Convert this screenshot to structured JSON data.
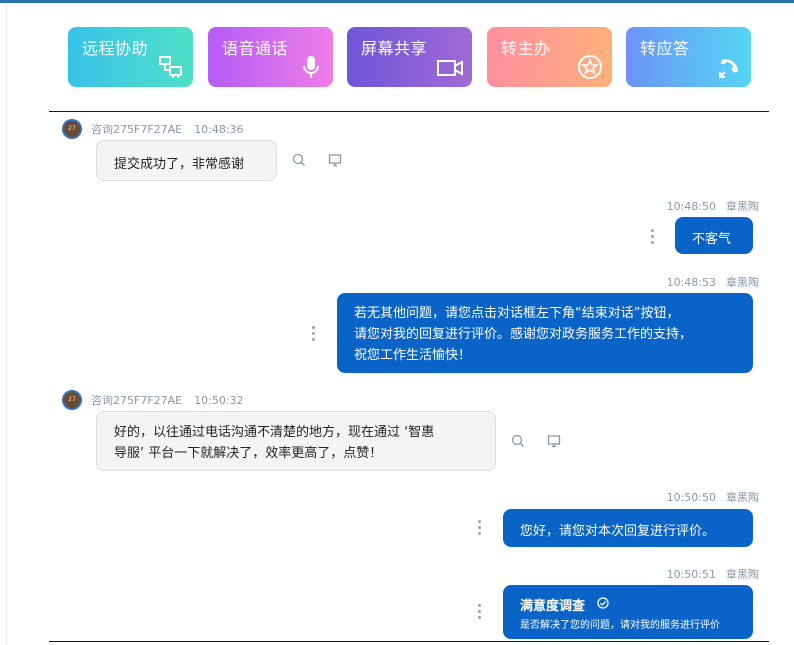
{
  "actions": [
    {
      "label": "远程协助",
      "icon": "remote-assist-icon"
    },
    {
      "label": "语音通话",
      "icon": "microphone-icon"
    },
    {
      "label": "屏幕共享",
      "icon": "video-camera-icon"
    },
    {
      "label": "转主办",
      "icon": "star-circle-icon"
    },
    {
      "label": "转应答",
      "icon": "phone-transfer-icon"
    }
  ],
  "messages": [
    {
      "sender": "咨询275F7F27AE",
      "time": "10:48:36",
      "avatar_text": "27",
      "text": "提交成功了，非常感谢"
    },
    {
      "sender": "章黑陶",
      "time": "10:48:50",
      "text": "不客气"
    },
    {
      "sender": "章黑陶",
      "time": "10:48:53",
      "lines": [
        "若无其他问题，请您点击对话框左下角“结束对话”按钮，",
        "请您对我的回复进行评价。感谢您对政务服务工作的支持，",
        "祝您工作生活愉快！"
      ]
    },
    {
      "sender": "咨询275F7F27AE",
      "time": "10:50:32",
      "avatar_text": "27",
      "lines": [
        "好的，以往通过电话沟通不清楚的地方，现在通过 ‘智惠",
        "导服’ 平台一下就解决了，效率更高了，点赞！"
      ]
    },
    {
      "sender": "章黑陶",
      "time": "10:50:50",
      "text": "您好，请您对本次回复进行评价。"
    },
    {
      "sender": "章黑陶",
      "time": "10:50:51",
      "title": "满意度调查",
      "subtitle": "是否解决了您的问题，请对我的服务进行评价"
    }
  ],
  "colors": {
    "accent": "#0a64c8",
    "incoming_bg": "#f4f4f5",
    "meta": "#8a96a8"
  }
}
